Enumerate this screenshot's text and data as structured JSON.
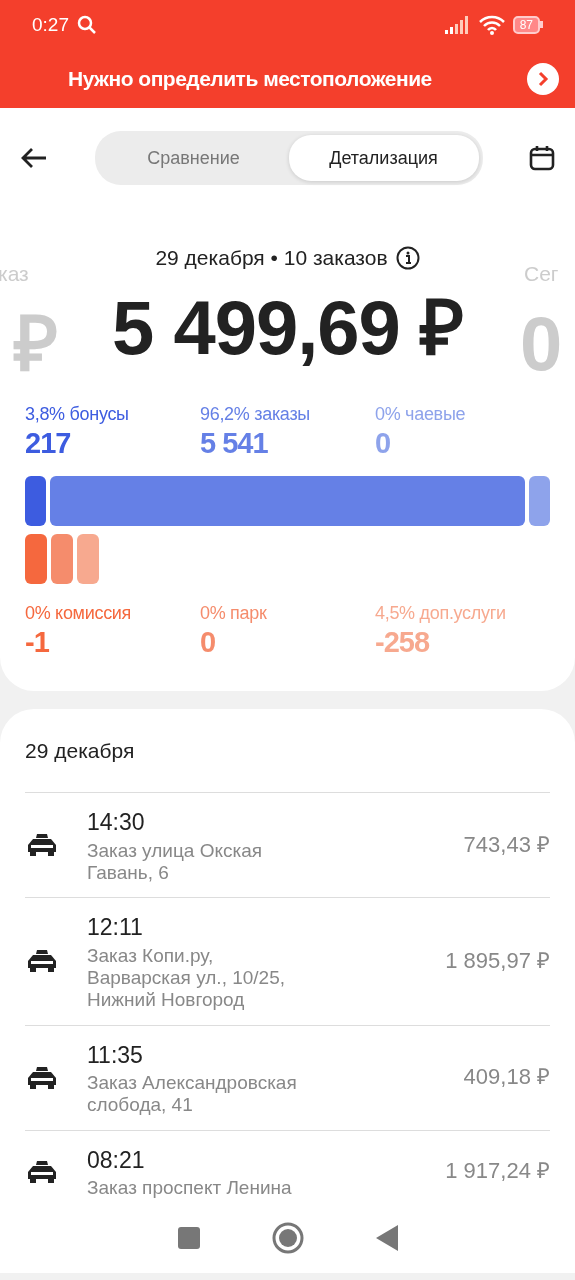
{
  "status_bar": {
    "time": "0:27",
    "battery": "87"
  },
  "banner": {
    "text": "Нужно определить местоположение"
  },
  "segments": [
    {
      "label": "Сравнение",
      "selected": false
    },
    {
      "label": "Детализация",
      "selected": true
    }
  ],
  "summary": {
    "prev": {
      "caption": "каз",
      "amount": "₽"
    },
    "caption": "29 декабря • 10 заказов",
    "amount": "5 499,69 ₽",
    "next": {
      "caption": "Сег",
      "amount": "0"
    }
  },
  "income": [
    {
      "label": "3,8% бонусы",
      "value": "217",
      "color": "#3d5ce0"
    },
    {
      "label": "96,2% заказы",
      "value": "5 541",
      "color": "#6580e6"
    },
    {
      "label": "0% чаевые",
      "value": "0",
      "color": "#8ea3eb"
    }
  ],
  "deductions": [
    {
      "label": "0% комиссия",
      "value": "-1",
      "color": "#f5683e"
    },
    {
      "label": "0% парк",
      "value": "0",
      "color": "#f58c6c"
    },
    {
      "label": "4,5% доп.услуги",
      "value": "-258",
      "color": "#f7a98f"
    }
  ],
  "orders": {
    "title": "29 декабря",
    "items": [
      {
        "time": "14:30",
        "address": "Заказ улица Окская Гавань, 6",
        "price": "743,43 ₽"
      },
      {
        "time": "12:11",
        "address": "Заказ Копи.ру, Варварская ул., 10/25, Нижний Новгород",
        "price": "1 895,97 ₽"
      },
      {
        "time": "11:35",
        "address": "Заказ Александровская слобода, 41",
        "price": "409,18 ₽"
      },
      {
        "time": "08:21",
        "address": "Заказ проспект Ленина",
        "price": "1 917,24 ₽"
      }
    ]
  }
}
